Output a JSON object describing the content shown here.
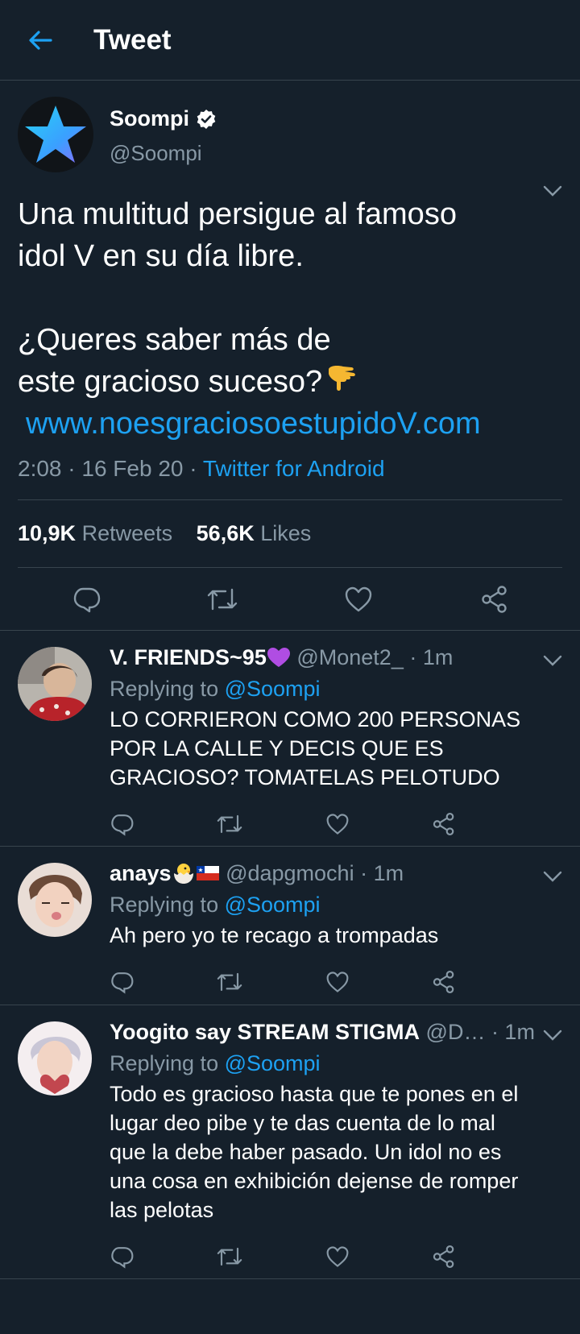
{
  "header": {
    "title": "Tweet"
  },
  "tweet": {
    "name": "Soompi",
    "handle": "@Soompi",
    "text_line1": "Una multitud persigue al famoso",
    "text_line2": "idol V en su día libre.",
    "text_line3": "¿Queres saber más de",
    "text_line4": "este gracioso suceso?",
    "link": "www.noesgraciosoestupidoV.com",
    "time": "2:08 · 16 Feb 20 · ",
    "source": "Twitter for Android",
    "retweets_count": "10,9K",
    "retweets_label": "Retweets",
    "likes_count": "56,6K",
    "likes_label": "Likes"
  },
  "replies": [
    {
      "name": "V. FRIENDS~95",
      "handle": "@Monet2_ · 1m",
      "replying": "Replying to ",
      "mention": "@Soompi",
      "text": "LO CORRIERON COMO 200 PERSONAS POR LA CALLE Y DECIS QUE ES GRACIOSO? TOMATELAS PELOTUDO"
    },
    {
      "name": "anays",
      "handle": "@dapgmochi · 1m",
      "replying": "Replying to ",
      "mention": "@Soompi",
      "text": "Ah pero yo te recago a trompadas"
    },
    {
      "name": "Yoogito say STREAM STIGMA",
      "handle": "@D… · 1m",
      "replying": "Replying to ",
      "mention": "@Soompi",
      "text": "Todo es gracioso hasta que te pones en el lugar deo pibe y te das cuenta de lo mal que la debe haber pasado. Un idol no es una cosa en exhibición dejense de romper las pelotas"
    }
  ],
  "colors": {
    "bg": "#15202b",
    "accent": "#1da1f2",
    "muted": "#8899a6",
    "divider": "#38444d"
  }
}
